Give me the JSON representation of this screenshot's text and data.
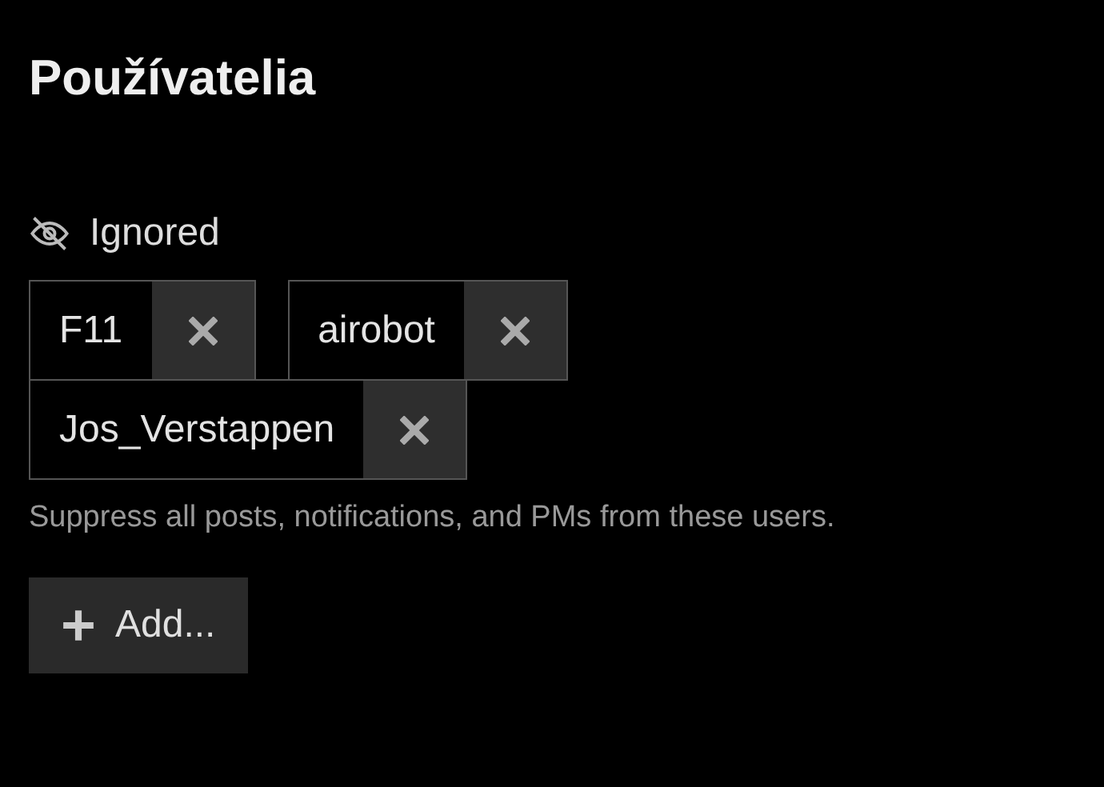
{
  "title": "Používatelia",
  "ignored": {
    "label": "Ignored",
    "users": [
      {
        "name": "F11"
      },
      {
        "name": "airobot"
      },
      {
        "name": "Jos_Verstappen"
      }
    ],
    "help": "Suppress all posts, notifications, and PMs from these users.",
    "add_button": "Add..."
  }
}
